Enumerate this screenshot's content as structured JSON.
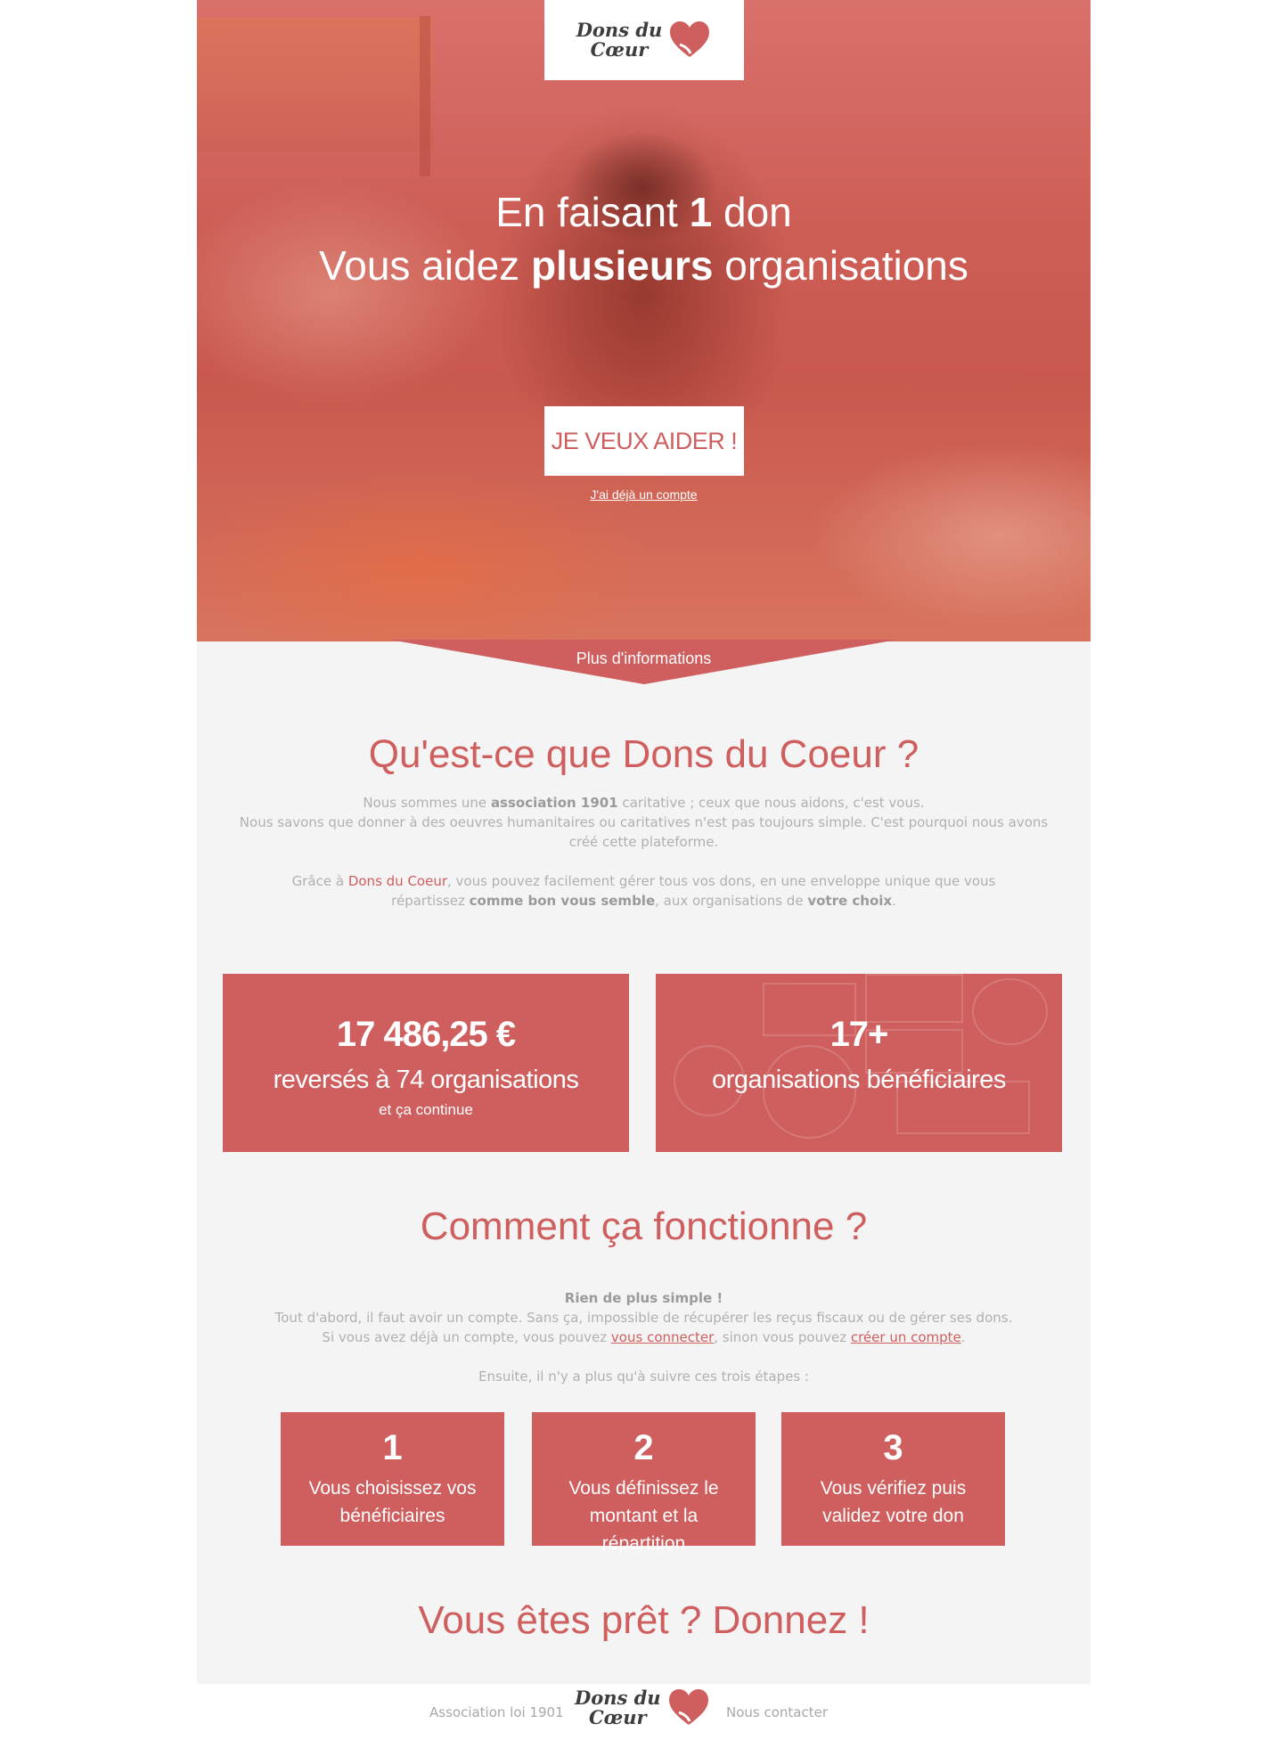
{
  "brand": {
    "logo_line1": "Dons du",
    "logo_line2": "Cœur",
    "accent_color": "#cf5e5e"
  },
  "hero": {
    "title_line1_pre": "En faisant ",
    "title_line1_bold": "1",
    "title_line1_post": " don",
    "title_line2_pre": "Vous aidez ",
    "title_line2_bold": "plusieurs",
    "title_line2_post": " organisations",
    "cta_label": "JE VEUX AIDER !",
    "login_link": "J'ai déjà un compte",
    "more_info": "Plus d'informations"
  },
  "about": {
    "title": "Qu'est-ce que Dons du Coeur ?",
    "p1_a": "Nous sommes une ",
    "p1_b": "association 1901",
    "p1_c": " caritative ; ceux que nous aidons, c'est vous.",
    "p2": "Nous savons que donner à des oeuvres humanitaires ou caritatives n'est pas toujours simple. C'est pourquoi nous avons créé cette plateforme.",
    "p3_a": "Grâce à ",
    "p3_b": "Dons du Coeur",
    "p3_c": ", vous pouvez facilement gérer tous vos dons, en une enveloppe unique que vous répartissez ",
    "p3_d": "comme bon vous semble",
    "p3_e": ", aux organisations de ",
    "p3_f": "votre choix",
    "p3_g": "."
  },
  "stats": {
    "amount": "17 486,25 €",
    "amount_caption": "reversés à 74 organisations",
    "amount_sub": "et ça continue",
    "orgs": "17+",
    "orgs_caption": "organisations bénéficiaires"
  },
  "how": {
    "title": "Comment ça fonctionne ?",
    "lead": "Rien de plus simple !",
    "line1": "Tout d'abord, il faut avoir un compte. Sans ça, impossible de récupérer les reçus fiscaux ou de gérer ses dons.",
    "line2_a": "Si vous avez déjà un compte, vous pouvez ",
    "line2_link1": "vous connecter",
    "line2_b": ", sinon vous pouvez ",
    "line2_link2": "créer un compte",
    "line2_c": ".",
    "line3": "Ensuite, il n'y a plus qu'à suivre ces trois étapes :",
    "steps": [
      {
        "num": "1",
        "text": "Vous choisissez vos bénéficiaires"
      },
      {
        "num": "2",
        "text": "Vous définissez le montant et la répartition"
      },
      {
        "num": "3",
        "text": "Vous vérifiez puis validez votre don"
      }
    ]
  },
  "closing": {
    "title": "Vous êtes prêt ? Donnez !"
  },
  "footer": {
    "left": "Association loi 1901",
    "right": "Nous contacter"
  }
}
